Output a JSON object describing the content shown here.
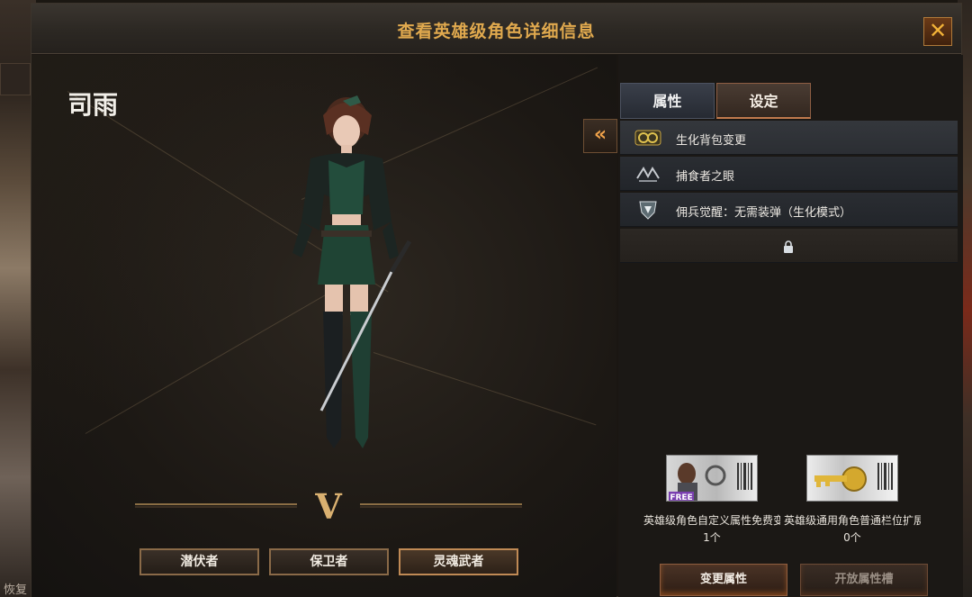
{
  "dialog": {
    "title": "查看英雄级角色详细信息",
    "close_glyph": "✕"
  },
  "background": {
    "bottom_left_text": "恢复"
  },
  "character": {
    "name": "司雨",
    "rank_mark": "V",
    "classes": [
      "潜伏者",
      "保卫者",
      "灵魂武者"
    ],
    "selected_class": "灵魂武者"
  },
  "tabs": {
    "attributes": "属性",
    "settings": "设定",
    "active": "设定"
  },
  "collapse_glyph": "«",
  "skills": [
    {
      "label": "生化背包变更",
      "icon": "bio-backpack-icon",
      "selected": true
    },
    {
      "label": "捕食者之眼",
      "icon": "predator-eye-icon",
      "selected": false
    },
    {
      "label": "佣兵觉醒：无需装弹（生化模式）",
      "icon": "mercenary-awaken-icon",
      "selected": false
    },
    {
      "label": "",
      "icon": "lock-icon",
      "locked": true
    }
  ],
  "items": [
    {
      "name": "英雄级角色自定义属性免费变更券",
      "count": "1个",
      "badge": "FREE",
      "icon": "free-coupon-icon"
    },
    {
      "name": "英雄级通用角色普通栏位扩展券",
      "count": "0个",
      "icon": "key-coupon-icon"
    }
  ],
  "buttons": {
    "change_attributes": "变更属性",
    "open_slot": "开放属性槽"
  },
  "colors": {
    "title_gold": "#e0a94e",
    "close_orange": "#f3b338",
    "tab_active_border": "#c07a4d"
  }
}
